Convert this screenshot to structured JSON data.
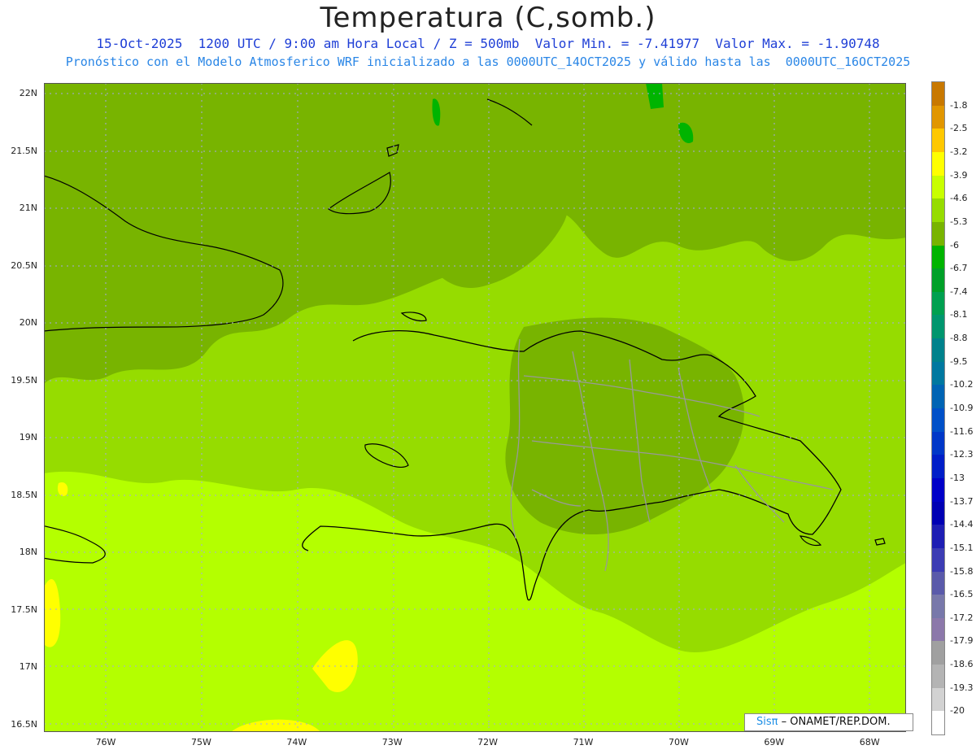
{
  "title": "Temperatura (C,somb.)",
  "subtitle_line1": "15-Oct-2025  1200 UTC / 9:00 am Hora Local / Z = 500mb  Valor Min. = -7.41977  Valor Max. = -1.90748",
  "subtitle_line2": "Pronóstico con el Modelo Atmosferico WRF inicializado a las 0000UTC_14OCT2025 y válido hasta las  0000UTC_16OCT2025",
  "credit": {
    "brand": "Sisπ",
    "separator": " – ",
    "org": "ONAMET/REP.DOM."
  },
  "axes": {
    "lat_labels": [
      "22N",
      "21.5N",
      "21N",
      "20.5N",
      "20N",
      "19.5N",
      "19N",
      "18.5N",
      "18N",
      "17.5N",
      "17N",
      "16.5N"
    ],
    "lon_labels": [
      "76W",
      "75W",
      "74W",
      "73W",
      "72W",
      "71W",
      "70W",
      "69W",
      "68W"
    ]
  },
  "legend": {
    "labels": [
      "-1.8",
      "-2.5",
      "-3.2",
      "-3.9",
      "-4.6",
      "-5.3",
      "-6",
      "-6.7",
      "-7.4",
      "-8.1",
      "-8.8",
      "-9.5",
      "-10.2",
      "-10.9",
      "-11.6",
      "-12.3",
      "-13",
      "-13.7",
      "-14.4",
      "-15.1",
      "-15.8",
      "-16.5",
      "-17.2",
      "-17.9",
      "-18.6",
      "-19.3",
      "-20"
    ],
    "colors": [
      "#c87800",
      "#e19600",
      "#ffc800",
      "#ffff00",
      "#c8ff00",
      "#96dc00",
      "#78b400",
      "#00b400",
      "#00a028",
      "#00a050",
      "#00966e",
      "#00828c",
      "#0078a0",
      "#0064b4",
      "#0050c8",
      "#0037c8",
      "#001ec8",
      "#0000c8",
      "#0000b4",
      "#1e1eb4",
      "#3c3cb4",
      "#5a5aaa",
      "#7878aa",
      "#8c78aa",
      "#a0a0a0",
      "#b4b4b4",
      "#d2d2d2",
      "#ffffff"
    ]
  },
  "field_colors": {
    "base": "#96dc00",
    "dark": "#78b400",
    "light": "#b4ff00",
    "yellow": "#ffff00",
    "green": "#00b400"
  }
}
